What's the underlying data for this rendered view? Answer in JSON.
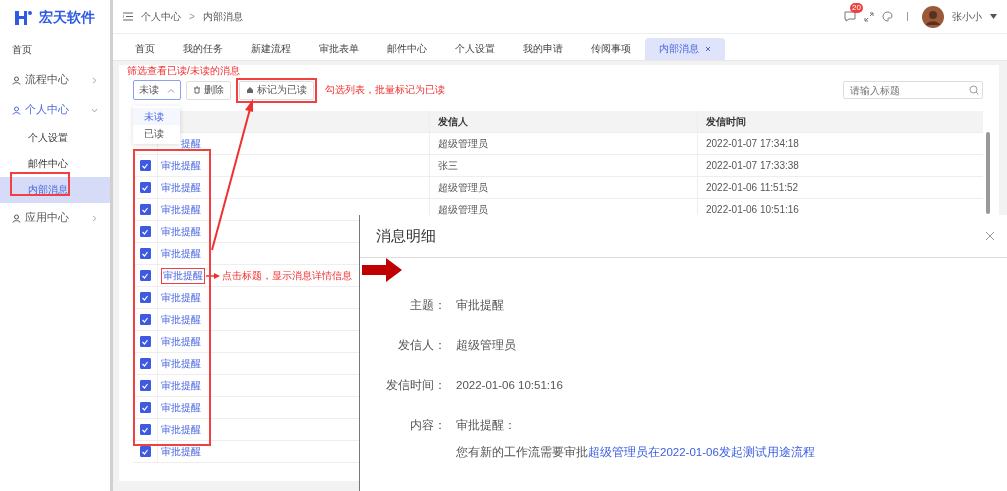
{
  "sidebar": {
    "logo": "宏天软件",
    "items": [
      {
        "label": "首页",
        "kind": "plain"
      },
      {
        "label": "流程中心",
        "kind": "group",
        "expanded": false
      },
      {
        "label": "个人中心",
        "kind": "group",
        "expanded": true,
        "children": [
          {
            "label": "个人设置",
            "selected": false
          },
          {
            "label": "邮件中心",
            "selected": false
          },
          {
            "label": "内部消息",
            "selected": true
          }
        ]
      },
      {
        "label": "应用中心",
        "kind": "group",
        "expanded": false
      }
    ]
  },
  "header": {
    "breadcrumb": [
      "个人中心",
      "内部消息"
    ],
    "breadcrumb_separator": ">",
    "message_badge": "20",
    "user": "张小小"
  },
  "tabs": [
    {
      "label": "首页",
      "selected": false
    },
    {
      "label": "我的任务",
      "selected": false
    },
    {
      "label": "新建流程",
      "selected": false
    },
    {
      "label": "审批表单",
      "selected": false
    },
    {
      "label": "邮件中心",
      "selected": false
    },
    {
      "label": "个人设置",
      "selected": false
    },
    {
      "label": "我的申请",
      "selected": false
    },
    {
      "label": "传阅事项",
      "selected": false
    },
    {
      "label": "内部消息",
      "selected": true
    }
  ],
  "toolbar": {
    "filter": {
      "value": "未读",
      "options": [
        {
          "label": "未读",
          "selected": true
        },
        {
          "label": "已读",
          "selected": false
        }
      ]
    },
    "delete_button": "删除",
    "mark_read_button": "标记为已读",
    "search": {
      "placeholder": "请输入标题"
    }
  },
  "table": {
    "columns": [
      "发信人",
      "发信时间"
    ],
    "rows": [
      {
        "title": "提醒",
        "covered": true,
        "sender": "超级管理员",
        "time": "2022-01-07 17:34:18"
      },
      {
        "title": "审批提醒",
        "checked": true,
        "sender": "张三",
        "time": "2022-01-07 17:33:38"
      },
      {
        "title": "审批提醒",
        "checked": true,
        "sender": "超级管理员",
        "time": "2022-01-06 11:51:52"
      },
      {
        "title": "审批提醒",
        "checked": true,
        "sender": "超级管理员",
        "time": "2022-01-06 10:51:16"
      },
      {
        "title": "审批提醒",
        "checked": true
      },
      {
        "title": "审批提醒",
        "checked": true
      },
      {
        "title": "审批提醒",
        "checked": true
      },
      {
        "title": "审批提醒",
        "checked": true
      },
      {
        "title": "审批提醒",
        "checked": true
      },
      {
        "title": "审批提醒",
        "checked": true
      },
      {
        "title": "审批提醒",
        "checked": true
      },
      {
        "title": "审批提醒",
        "checked": true
      },
      {
        "title": "审批提醒",
        "checked": true
      },
      {
        "title": "审批提醒",
        "checked": true
      },
      {
        "title": "审批提醒",
        "checked": true
      }
    ]
  },
  "detail": {
    "title": "消息明细",
    "fields": [
      {
        "label": "主题：",
        "value": "审批提醒"
      },
      {
        "label": "发信人：",
        "value": "超级管理员"
      },
      {
        "label": "发信时间：",
        "value": "2022-01-06 10:51:16"
      },
      {
        "label": "内容：",
        "value": "审批提醒："
      }
    ],
    "message_prefix": "您有新的工作流需要审批",
    "message_link": "超级管理员在2022-01-06发起测试用途流程"
  },
  "annotations": {
    "filter_note": "筛选查看已读/未读的消息",
    "mark_note": "勾选列表，批量标记为已读",
    "click_note": "点击标题，显示消息详情信息"
  }
}
